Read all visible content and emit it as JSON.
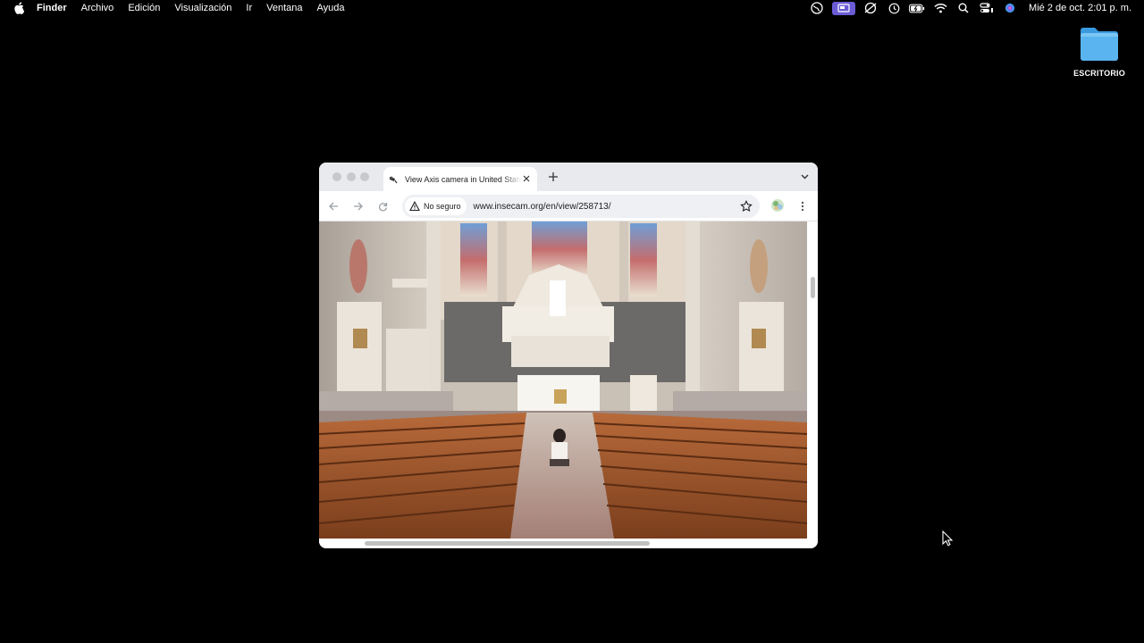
{
  "menubar": {
    "app_name": "Finder",
    "items": [
      "Archivo",
      "Edición",
      "Visualización",
      "Ir",
      "Ventana",
      "Ayuda"
    ],
    "clock": "Mié 2 de oct.  2:01 p. m.",
    "status_icons": [
      "vpn-globe-icon",
      "screen-mirror-icon",
      "accessibility-icon",
      "time-machine-icon",
      "battery-charging-icon",
      "wifi-icon",
      "spotlight-search-icon",
      "control-center-icon",
      "siri-icon"
    ]
  },
  "desktop": {
    "folder_label": "ESCRITORIO",
    "folder_color": "#5ab4ef"
  },
  "browser": {
    "tab_title": "View Axis camera in United States",
    "security_chip": "No seguro",
    "url": "www.insecam.org/en/view/258713/"
  },
  "colors": {
    "desktop_bg": "#000000",
    "menubar_active": "#6b5cd6",
    "tabstrip_bg": "#e9eaed",
    "omnibox_bg": "#eef0f3"
  }
}
